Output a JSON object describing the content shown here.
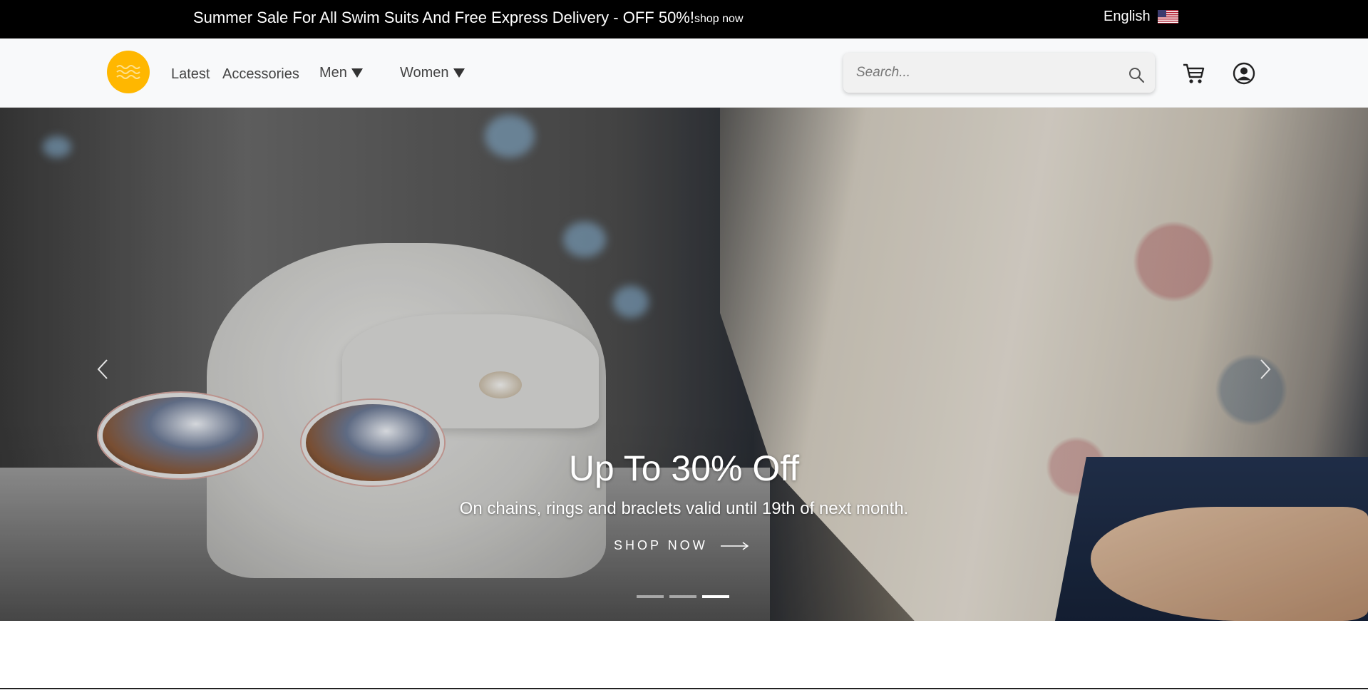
{
  "topbar": {
    "promo_text": "Summer Sale For All Swim Suits And Free Express Delivery - OFF 50%!",
    "promo_link": "shop now",
    "language": "English",
    "language_flag_icon": "us-flag-icon"
  },
  "navbar": {
    "logo_icon": "waves-logo-icon",
    "links": [
      {
        "label": "Latest"
      },
      {
        "label": "Accessories"
      }
    ],
    "dropdowns": [
      {
        "label": "Men"
      },
      {
        "label": "Women"
      }
    ],
    "search": {
      "placeholder": "Search...",
      "value": ""
    },
    "icons": [
      "search-icon",
      "cart-icon",
      "user-icon"
    ]
  },
  "hero": {
    "title": "Up To 30% Off",
    "text": "On chains, rings and braclets valid until 19th of next month.",
    "cta_label": "SHOP NOW",
    "slide_count": 3,
    "active_slide": 3
  },
  "colors": {
    "topbar_bg": "#000000",
    "navbar_bg": "#f8f9fa",
    "logo_bg": "#ffb700"
  }
}
